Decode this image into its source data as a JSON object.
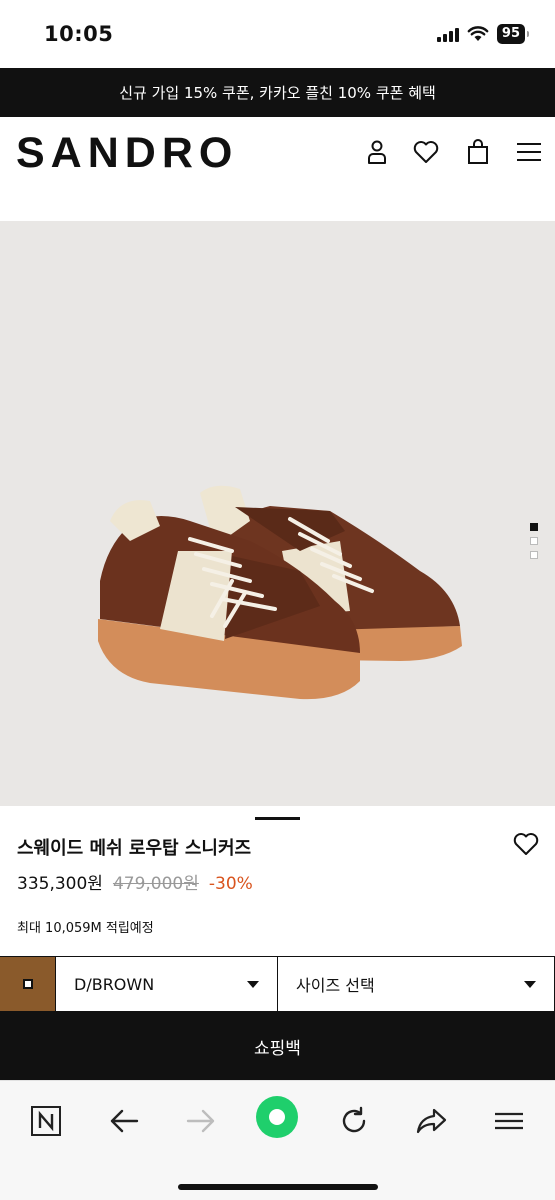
{
  "status_bar": {
    "time": "10:05",
    "battery": "95"
  },
  "promo_banner": {
    "text": "신규 가입 15% 쿠폰, 카카오 플친 10% 쿠폰 혜택"
  },
  "header": {
    "logo": "SANDRO",
    "icons": [
      "account-icon",
      "wishlist-icon",
      "cart-icon",
      "menu-icon"
    ]
  },
  "product": {
    "name": "스웨이드 메쉬 로우탑 스니커즈",
    "price": "335,300원",
    "original_price": "479,000원",
    "discount": "-30%",
    "points": "최대 10,059M 적립예정",
    "color_swatch": "#8a5a2b",
    "image_dots": {
      "count": 3,
      "active": 1
    }
  },
  "options": {
    "color": "D/BROWN",
    "size_placeholder": "사이즈 선택"
  },
  "cart_button": {
    "label": "쇼핑백"
  },
  "browser_toolbar": {
    "items": [
      "naver-icon",
      "back-arrow-icon",
      "forward-arrow-icon",
      "green-dot-icon",
      "refresh-icon",
      "share-icon",
      "menu-icon"
    ]
  }
}
